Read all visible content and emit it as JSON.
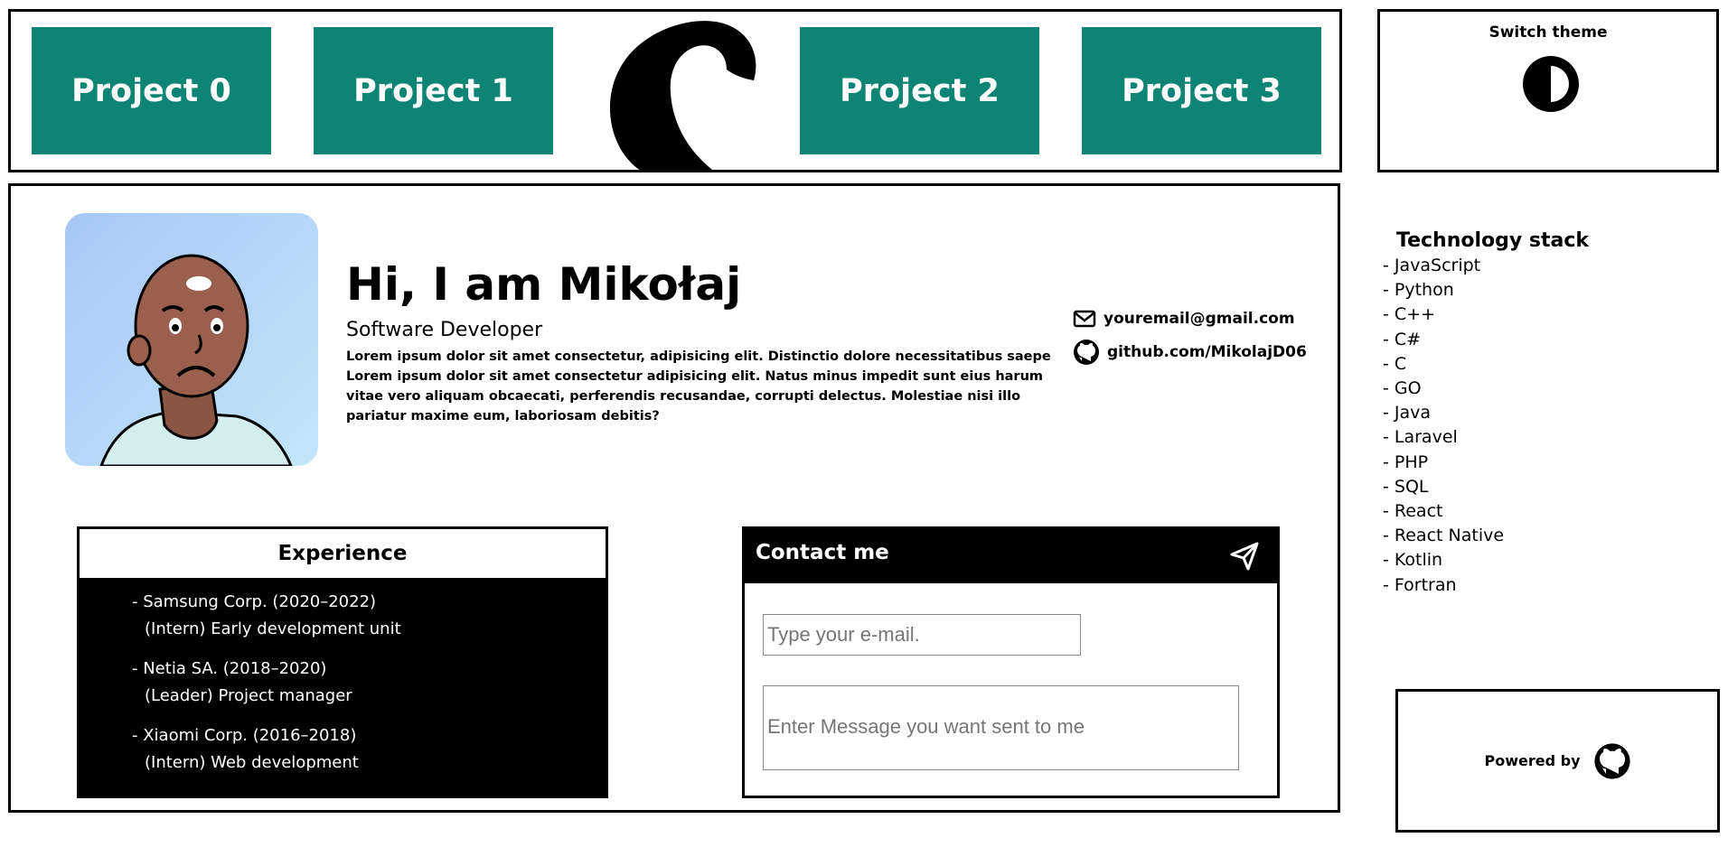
{
  "header": {
    "projects": [
      "Project 0",
      "Project 1",
      "Project 2",
      "Project 3"
    ],
    "logo_icon": "tentacle-logo"
  },
  "theme": {
    "title": "Switch theme",
    "icon": "contrast-toggle-icon"
  },
  "profile": {
    "greeting": "Hi, I am Mikołaj",
    "job_title": "Software Developer",
    "bio_line1": "Lorem ipsum dolor sit amet consectetur, adipisicing elit. Distinctio dolore necessitatibus saepe",
    "bio_line2": "Lorem ipsum dolor sit amet consectetur adipisicing elit. Natus minus impedit sunt eius harum vitae vero aliquam obcaecati, perferendis recusandae, corrupti delectus. Molestiae nisi illo pariatur maxime eum, laboriosam debitis?",
    "email": "youremail@gmail.com",
    "github": "github.com/MikolajD06"
  },
  "experience": {
    "title": "Experience",
    "items": [
      {
        "company": "- Samsung Corp. (2020–2022)",
        "role": "(Intern) Early development unit"
      },
      {
        "company": "- Netia SA. (2018–2020)",
        "role": "(Leader) Project manager"
      },
      {
        "company": "- Xiaomi Corp. (2016–2018)",
        "role": "(Intern) Web development"
      }
    ]
  },
  "contact": {
    "title": "Contact me",
    "email_placeholder": "Type your e-mail.",
    "message_placeholder": "Enter Message you want sent to me"
  },
  "tech_stack": {
    "title": "Technology stack",
    "items": [
      "- JavaScript",
      "- Python",
      "- C++",
      "- C#",
      "- C",
      "- GO",
      "- Java",
      "- Laravel",
      "- PHP",
      "- SQL",
      "- React",
      "- React Native",
      "- Kotlin",
      "- Fortran"
    ]
  },
  "footer": {
    "powered_label": "Powered by"
  },
  "colors": {
    "accent": "#0e8574",
    "avatar_bg_start": "#a7c8f7",
    "avatar_bg_end": "#c2e6f8"
  }
}
